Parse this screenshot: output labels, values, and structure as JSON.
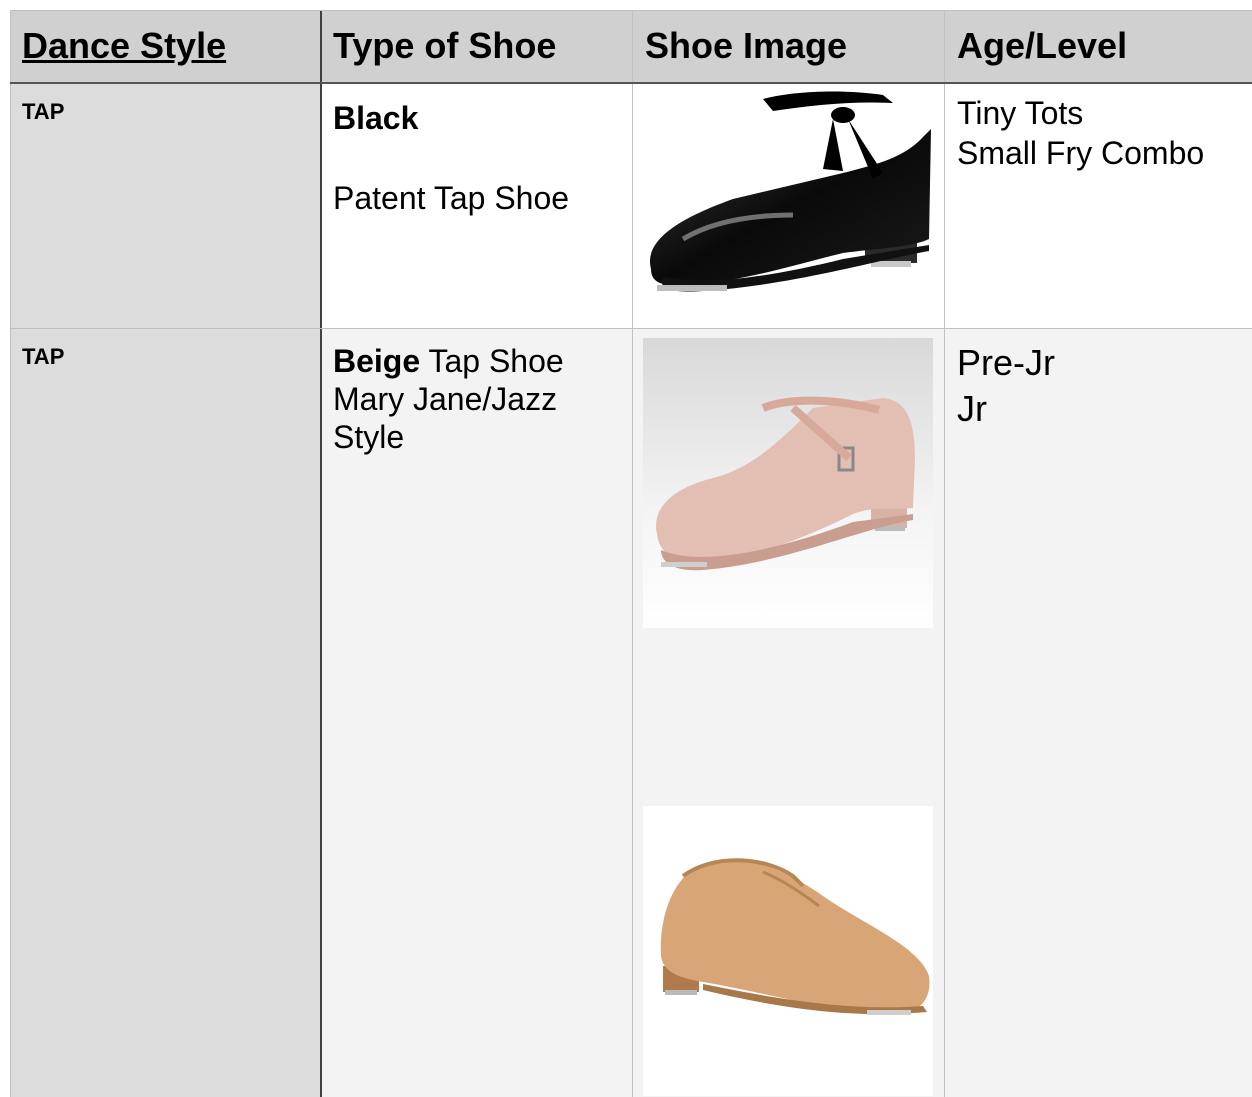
{
  "header": {
    "dance_style": "Dance Style",
    "type_of_shoe": "Type of Shoe",
    "shoe_image": "Shoe Image",
    "age_level": "Age/Level"
  },
  "rows": [
    {
      "style": "TAP",
      "type_bold": "Black",
      "type_rest": "Patent Tap Shoe",
      "age_lines": [
        "Tiny Tots",
        "Small Fry Combo"
      ]
    },
    {
      "style": "TAP",
      "type_bold": "Beige",
      "type_rest_1": " Tap Shoe",
      "type_rest_2": "Mary Jane/Jazz",
      "type_rest_3": "Style",
      "age_lines": [
        "Pre-Jr",
        "Jr"
      ]
    }
  ],
  "colors": {
    "header_bg": "#d0d0d0",
    "style_col_bg": "#dcdcdc",
    "row2_bg": "#f3f3f3",
    "black_shoe": "#0a0a0a",
    "pink_shoe": "#e3bfb3",
    "tan_shoe": "#d8a676"
  },
  "icons": [
    "black-patent-tap-shoe-image",
    "beige-mary-jane-tap-shoe-image",
    "tan-slip-on-jazz-tap-shoe-image"
  ]
}
